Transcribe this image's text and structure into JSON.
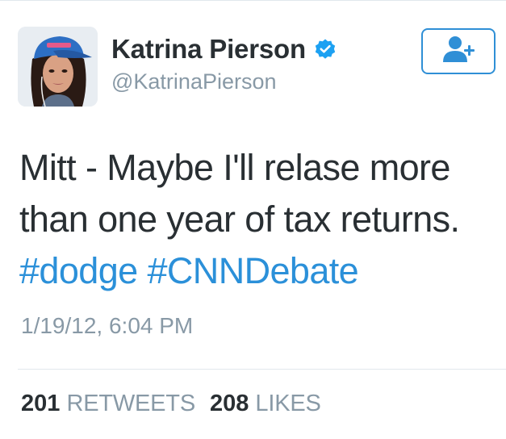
{
  "user": {
    "display_name": "Katrina Pierson",
    "handle": "@KatrinaPierson",
    "verified": true,
    "avatar": "profile-photo"
  },
  "follow_button": {
    "icon": "add-user-icon",
    "color": "#2f8fd6"
  },
  "tweet": {
    "line1": "Mitt - Maybe I'll relase more",
    "line2": "than one year of tax returns.",
    "hashtags": [
      "#dodge",
      "#CNNDebate"
    ],
    "timestamp": "1/19/12, 6:04 PM"
  },
  "stats": {
    "retweets_count": "201",
    "retweets_label": "RETWEETS",
    "likes_count": "208",
    "likes_label": "LIKES"
  },
  "colors": {
    "link": "#2b90d9",
    "secondary_text": "#8899a6",
    "primary_text": "#292f33",
    "verified_badge": "#1da1f2"
  }
}
